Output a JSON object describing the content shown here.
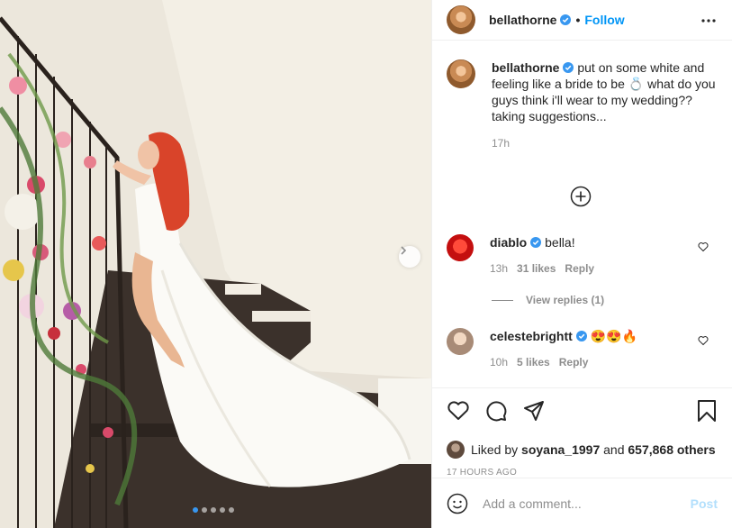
{
  "post": {
    "author": "bellathorne",
    "follow_label": "Follow",
    "follow_sep": "•",
    "caption": "put on some white and feeling like a bride to be 💍 what do you guys think i'll wear to my wedding?? taking suggestions...",
    "caption_time": "17h",
    "carousel": {
      "slides": 5,
      "active_slide": 1
    }
  },
  "comments": [
    {
      "username": "diablo",
      "text": "bella!",
      "time": "13h",
      "likes": "31 likes",
      "reply": "Reply",
      "view_replies": "View replies (1)"
    },
    {
      "username": "celestebrightt",
      "text": "😍😍🔥",
      "time": "10h",
      "likes": "5 likes",
      "reply": "Reply"
    }
  ],
  "likes": {
    "prefix": "Liked by",
    "user": "soyana_1997",
    "middle": "and",
    "count": "657,868 others"
  },
  "post_age": "17 HOURS AGO",
  "composer": {
    "placeholder": "Add a comment...",
    "post_label": "Post"
  },
  "colors": {
    "accent": "#0095f6",
    "post_disabled": "#b2dffc",
    "muted": "#8e8e8e",
    "text": "#262626"
  },
  "icons": [
    "verified-badge-icon",
    "more-options-icon",
    "load-more-comments-icon",
    "heart-icon",
    "comment-icon",
    "share-icon",
    "bookmark-icon",
    "emoji-icon",
    "chevron-right-icon"
  ]
}
